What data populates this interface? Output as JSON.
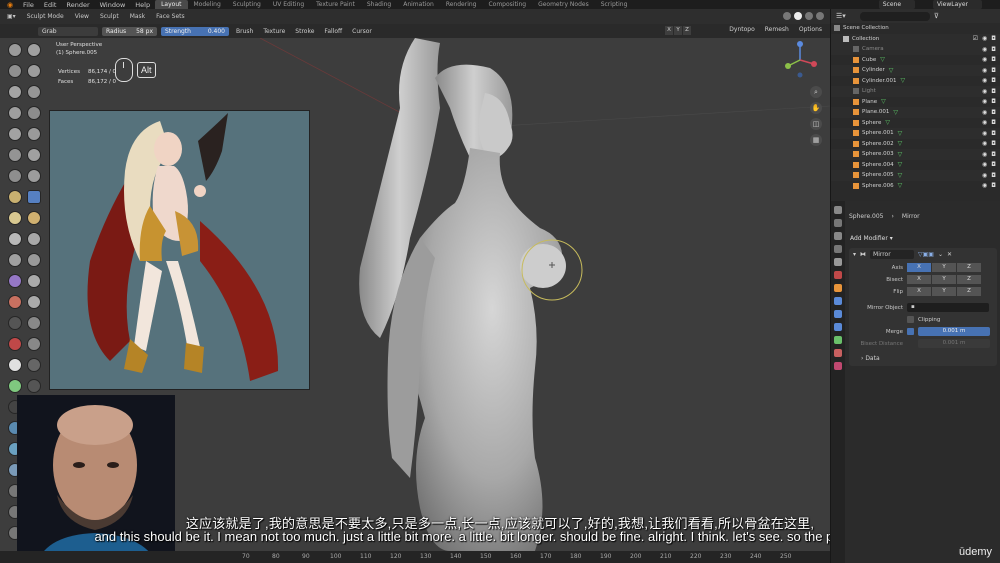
{
  "topbar": {
    "menus": [
      "File",
      "Edit",
      "Render",
      "Window",
      "Help"
    ],
    "workspaces": [
      "Layout",
      "Modeling",
      "Sculpting",
      "UV Editing",
      "Texture Paint",
      "Shading",
      "Animation",
      "Rendering",
      "Compositing",
      "Geometry Nodes",
      "Scripting"
    ],
    "active_workspace": "Layout",
    "scene_label": "Scene",
    "view_layer_label": "ViewLayer"
  },
  "header": {
    "mode": "Sculpt Mode",
    "menus": [
      "View",
      "Sculpt",
      "Mask",
      "Face Sets"
    ]
  },
  "toolsettings": {
    "brush_name": "Grab",
    "radius_label": "Radius",
    "radius_value": "58 px",
    "strength_label": "Strength",
    "strength_value": "0.400",
    "dropdowns": [
      "Brush",
      "Texture",
      "Stroke",
      "Falloff",
      "Cursor"
    ],
    "axis_buttons": [
      "X",
      "Y",
      "Z"
    ],
    "right": [
      "Dyntopo",
      "Remesh",
      "Options"
    ]
  },
  "viewport": {
    "perspective": "User Perspective",
    "object": "(1) Sphere.005",
    "stats": [
      {
        "label": "Vertices",
        "value": "86,174 / 0"
      },
      {
        "label": "Faces",
        "value": "86,172 / 0"
      }
    ],
    "key_hint": "Alt"
  },
  "outliner": {
    "root": "Scene Collection",
    "collection": "Collection",
    "items": [
      {
        "name": "Camera",
        "dim": true
      },
      {
        "name": "Cube",
        "dim": false
      },
      {
        "name": "Cylinder",
        "dim": false
      },
      {
        "name": "Cylinder.001",
        "dim": false
      },
      {
        "name": "Light",
        "dim": true
      },
      {
        "name": "Plane",
        "dim": false
      },
      {
        "name": "Plane.001",
        "dim": false
      },
      {
        "name": "Sphere",
        "dim": false
      },
      {
        "name": "Sphere.001",
        "dim": false
      },
      {
        "name": "Sphere.002",
        "dim": false
      },
      {
        "name": "Sphere.003",
        "dim": false
      },
      {
        "name": "Sphere.004",
        "dim": false
      },
      {
        "name": "Sphere.005",
        "dim": false
      },
      {
        "name": "Sphere.006",
        "dim": false
      }
    ]
  },
  "properties": {
    "object": "Sphere.005",
    "modifier_breadcrumb": "Mirror",
    "add_modifier": "Add Modifier",
    "modifier_name": "Mirror",
    "axis_label": "Axis",
    "bisect_label": "Bisect",
    "flip_label": "Flip",
    "xyz": [
      "X",
      "Y",
      "Z"
    ],
    "mirror_object_label": "Mirror Object",
    "clipping_label": "Clipping",
    "merge_label": "Merge",
    "merge_value": "0.001 m",
    "bisect_distance_label": "Bisect Distance",
    "bisect_distance_value": "0.001 m",
    "data_label": "Data"
  },
  "timeline": {
    "ticks": [
      "70",
      "80",
      "90",
      "100",
      "110",
      "120",
      "130",
      "140",
      "150",
      "160",
      "170",
      "180",
      "190",
      "200",
      "210",
      "220",
      "230",
      "240",
      "250"
    ]
  },
  "subtitles": {
    "chinese": "这应该就是了,我的意思是不要太多,只是多一点,长一点,应该就可以了,好的,我想,让我们看看,所以骨盆在这里,",
    "english": "and this should be it. I mean not too much. just a little bit more. a little. bit longer. should be fine. alright. I think. let's see. so the pelvis is here."
  },
  "watermark": "ūdemy",
  "colors": {
    "accent_blue": "#4772b3",
    "blender_orange": "#e87d0d",
    "outliner_green": "#5ecf6a",
    "viewport_bg": "#3d3d3d"
  }
}
